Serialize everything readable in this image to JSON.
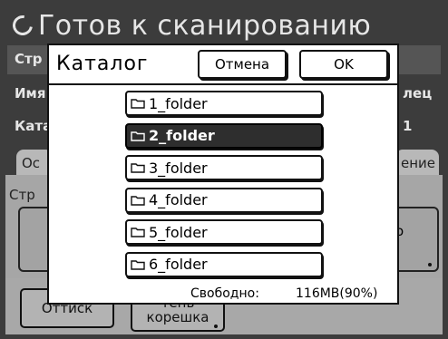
{
  "background": {
    "title": "Готов к сканированию",
    "rows": [
      "Стр",
      "Имя",
      "Ката"
    ],
    "right_fragments": [
      "лец",
      "1"
    ],
    "tabs": [
      "Ос",
      "ение"
    ],
    "panel_label": "Стр",
    "panel_button_fragment": "о",
    "bottom_buttons": [
      "Оттиск",
      "тень\nкорешка"
    ]
  },
  "dialog": {
    "title": "Каталог",
    "cancel_label": "Отмена",
    "ok_label": "OK",
    "folders": [
      {
        "name": "1_folder",
        "selected": false
      },
      {
        "name": "2_folder",
        "selected": true
      },
      {
        "name": "3_folder",
        "selected": false
      },
      {
        "name": "4_folder",
        "selected": false
      },
      {
        "name": "5_folder",
        "selected": false
      },
      {
        "name": "6_folder",
        "selected": false
      }
    ],
    "free_label": "Свободно:",
    "free_value": "116MB(90%)"
  }
}
